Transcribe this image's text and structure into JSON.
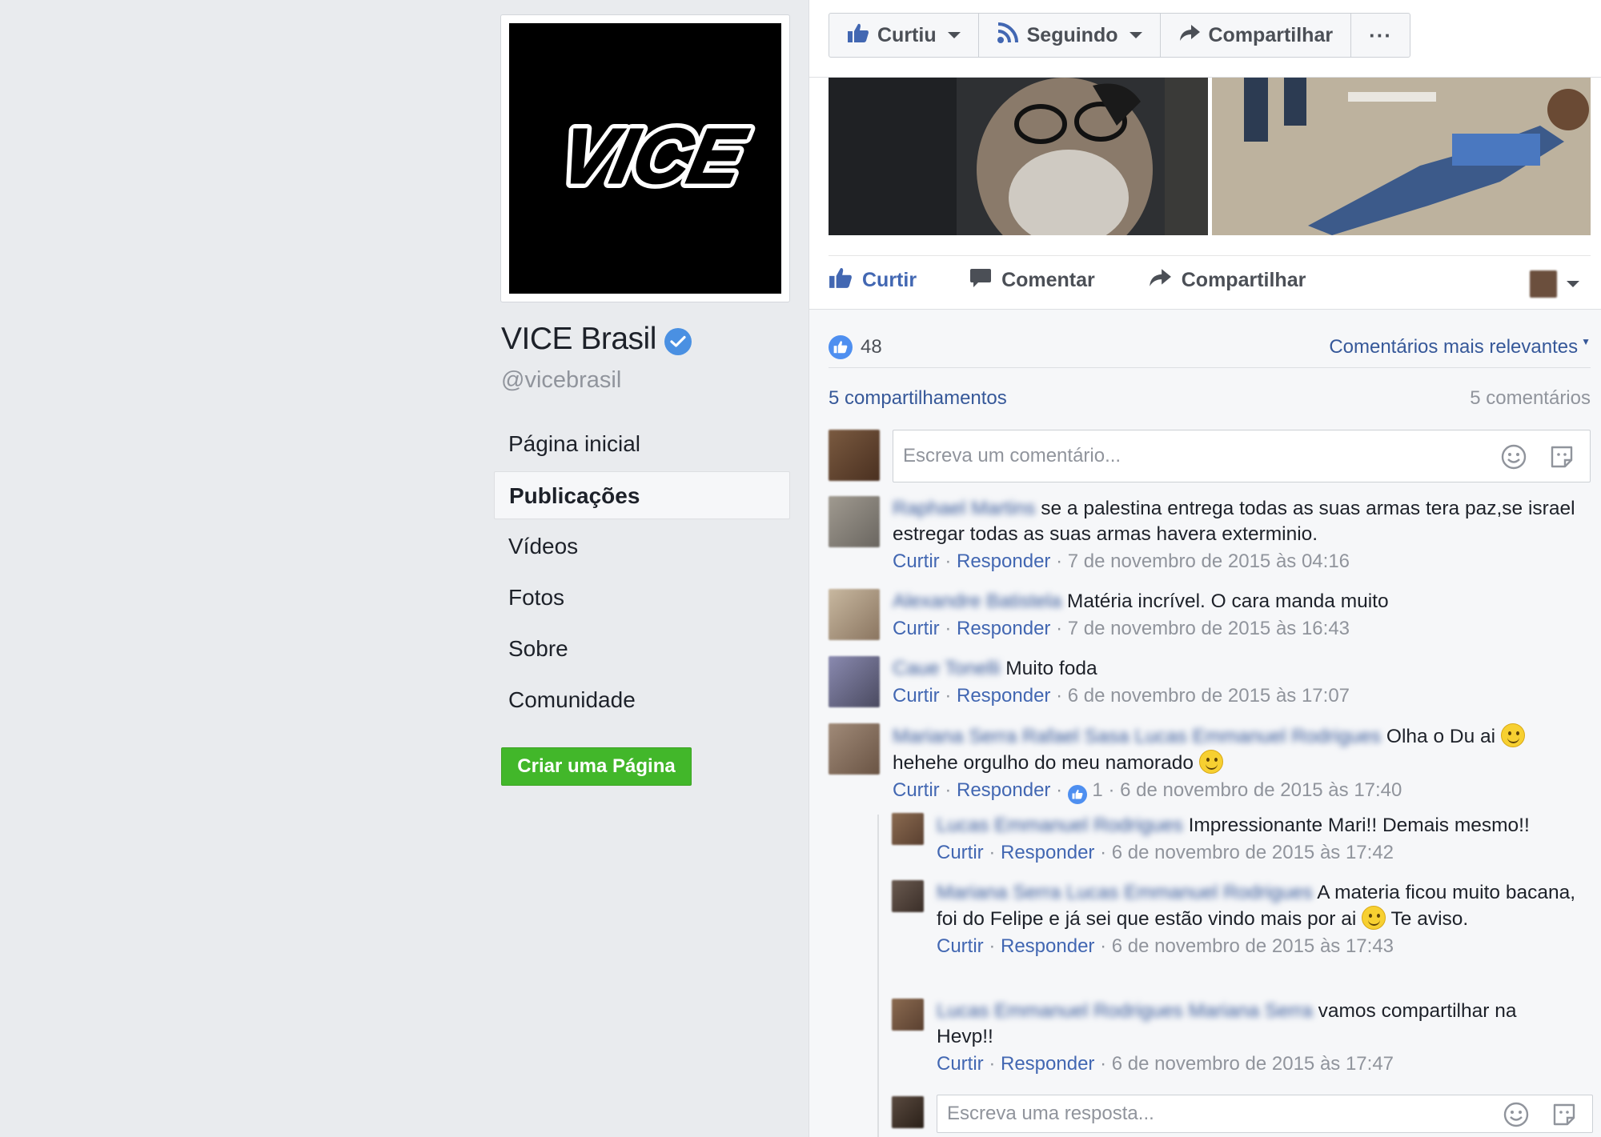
{
  "page": {
    "logo_text": "VICE",
    "name": "VICE Brasil",
    "handle": "@vicebrasil",
    "verified": true
  },
  "nav": {
    "items": [
      {
        "label": "Página inicial",
        "active": false
      },
      {
        "label": "Publicações",
        "active": true
      },
      {
        "label": "Vídeos",
        "active": false
      },
      {
        "label": "Fotos",
        "active": false
      },
      {
        "label": "Sobre",
        "active": false
      },
      {
        "label": "Comunidade",
        "active": false
      }
    ],
    "create_page": "Criar uma Página"
  },
  "header_actions": {
    "liked": "Curtiu",
    "following": "Seguindo",
    "share": "Compartilhar",
    "more": "···"
  },
  "post": {
    "actions": {
      "like": "Curtir",
      "comment": "Comentar",
      "share": "Compartilhar"
    },
    "reactions_count": "48",
    "sort_label": "Comentários mais relevantes",
    "shares": "5 compartilhamentos",
    "comments_count": "5 comentários",
    "comment_placeholder": "Escreva um comentário...",
    "reply_placeholder": "Escreva uma resposta..."
  },
  "comments": [
    {
      "author": "Raphael Martins",
      "text": "se a palestina entrega todas as suas armas tera paz,se israel estregar todas as suas armas havera exterminio.",
      "like": "Curtir",
      "reply": "Responder",
      "time": "7 de novembro de 2015 às 04:16"
    },
    {
      "author": "Alexandre Batistela",
      "text": "Matéria incrível. O cara manda muito",
      "like": "Curtir",
      "reply": "Responder",
      "time": "7 de novembro de 2015 às 16:43"
    },
    {
      "author": "Caue Tonelli",
      "text": "Muito foda",
      "like": "Curtir",
      "reply": "Responder",
      "time": "6 de novembro de 2015 às 17:07"
    },
    {
      "author": "Mariana Serra Rafael Sasa Lucas Emmanuel Rodrigues",
      "text_1": "Olha o Du ai",
      "text_2": "hehehe orgulho do meu namorado",
      "like": "Curtir",
      "reply": "Responder",
      "like_count": "1",
      "time": "6 de novembro de 2015 às 17:40"
    }
  ],
  "replies": [
    {
      "author": "Lucas Emmanuel Rodrigues",
      "text": "Impressionante Mari!! Demais mesmo!!",
      "like": "Curtir",
      "reply": "Responder",
      "time": "6 de novembro de 2015 às 17:42"
    },
    {
      "author": "Mariana Serra Lucas Emmanuel Rodrigues",
      "text_1": "A materia ficou muito bacana, foi do Felipe e já sei que estão vindo mais por ai",
      "text_2": "Te aviso.",
      "like": "Curtir",
      "reply": "Responder",
      "time": "6 de novembro de 2015 às 17:43"
    },
    {
      "author": "Lucas Emmanuel Rodrigues Mariana Serra",
      "text": "vamos compartilhar na Hevp!!",
      "like": "Curtir",
      "reply": "Responder",
      "time": "6 de novembro de 2015 às 17:47"
    }
  ],
  "colors": {
    "link": "#365899",
    "accent": "#4267b2",
    "green": "#42b72a",
    "background": "#e9ebee"
  }
}
